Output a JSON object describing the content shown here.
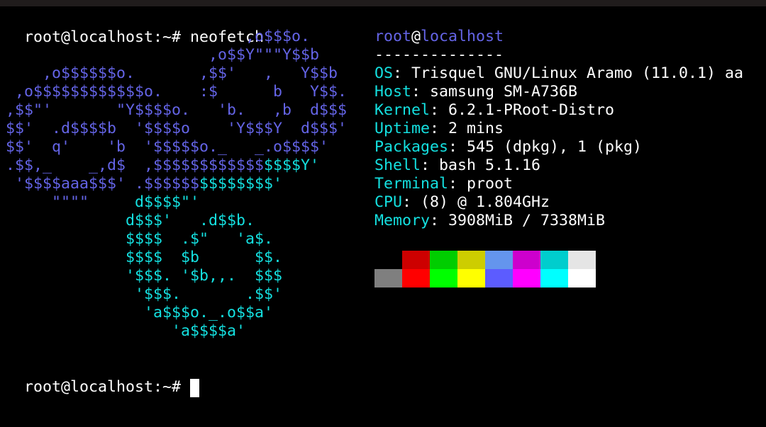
{
  "colors": {
    "background": "#000000",
    "text": "#ffffff",
    "accent_blue": "#6464e6",
    "accent_cyan": "#14e0e0",
    "cursor": "#ffffff",
    "topbar": "#201c1c"
  },
  "terminal": {
    "command_prompt": "root@localhost:~# ",
    "command": "neofetch",
    "final_prompt": "root@localhost:~# "
  },
  "ascii_logo": [
    [
      {
        "t": "                          ,o$$$o.",
        "c": "b"
      }
    ],
    [
      {
        "t": "                      ,o$$Y\"\"\"Y$$b",
        "c": "b"
      }
    ],
    [
      {
        "t": "    ,o$$$$$$o.       ,$$'   ,   Y$$b",
        "c": "b"
      }
    ],
    [
      {
        "t": " ,o$$$$$$$$$$$$o.    :$      b   Y$$.",
        "c": "b"
      }
    ],
    [
      {
        "t": ",$$\"'       \"Y$$$$o.   'b.   ,b  d$$$",
        "c": "b"
      }
    ],
    [
      {
        "t": "$$'  .d$$$$b  '$$$$o    'Y$$$Y  d$$$'",
        "c": "b"
      }
    ],
    [
      {
        "t": "$$'  q'    'b  '$$$$$o._   _.o$$$$'",
        "c": "b"
      }
    ],
    [
      {
        "t": ".$$,_    _,d$  ,$$$$$$$$$$$$",
        "c": "b"
      },
      {
        "t": "$$$$Y'",
        "c": "c"
      }
    ],
    [
      {
        "t": " '$$$$aaa$$$' .$$$$$$",
        "c": "b"
      },
      {
        "t": "$$$$$$$$'",
        "c": "c"
      }
    ],
    [
      {
        "t": "     \"\"\"\"     ",
        "c": "b"
      },
      {
        "t": "d$$$$\"'",
        "c": "c"
      }
    ],
    [
      {
        "t": "             d$$$'   .d$$b.",
        "c": "c"
      }
    ],
    [
      {
        "t": "             $$$$  .$\"   'a$.",
        "c": "c"
      }
    ],
    [
      {
        "t": "             $$$$  $b      $$.",
        "c": "c"
      }
    ],
    [
      {
        "t": "             '$$$. '$b,,.  $$$",
        "c": "c"
      }
    ],
    [
      {
        "t": "              '$$$.       .$$'",
        "c": "c"
      }
    ],
    [
      {
        "t": "               'a$$$o._.o$$a'",
        "c": "c"
      }
    ],
    [
      {
        "t": "                  'a$$$$a'",
        "c": "c"
      }
    ]
  ],
  "info": {
    "user": "root",
    "at": "@",
    "host": "localhost",
    "separator": "--------------",
    "fields": [
      {
        "key": "OS",
        "value": "Trisquel GNU/Linux Aramo (11.0.1) aa"
      },
      {
        "key": "Host",
        "value": "samsung SM-A736B"
      },
      {
        "key": "Kernel",
        "value": "6.2.1-PRoot-Distro"
      },
      {
        "key": "Uptime",
        "value": "2 mins"
      },
      {
        "key": "Packages",
        "value": "545 (dpkg), 1 (pkg)"
      },
      {
        "key": "Shell",
        "value": "bash 5.1.16"
      },
      {
        "key": "Terminal",
        "value": "proot"
      },
      {
        "key": "CPU",
        "value": "(8) @ 1.804GHz"
      },
      {
        "key": "Memory",
        "value": "3908MiB / 7338MiB"
      }
    ],
    "field_separator": ": "
  },
  "palette": {
    "normal": [
      "#000000",
      "#cd0000",
      "#00cd00",
      "#cdcd00",
      "#6495ed",
      "#cd00cd",
      "#00cdcd",
      "#e5e5e5"
    ],
    "bright": [
      "#7f7f7f",
      "#ff0000",
      "#00ff00",
      "#ffff00",
      "#5c5cff",
      "#ff00ff",
      "#00ffff",
      "#ffffff"
    ]
  }
}
